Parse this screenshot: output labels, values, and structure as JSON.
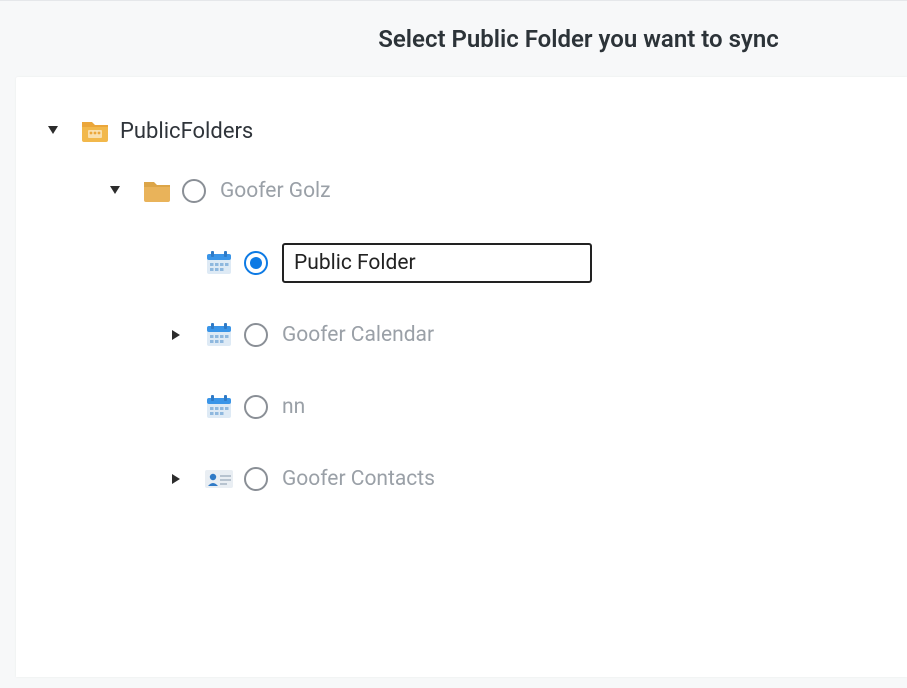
{
  "header": {
    "title": "Select Public Folder you want to sync"
  },
  "tree": {
    "root": {
      "label": "PublicFolders",
      "expanded": true,
      "icon": "folder-people",
      "children": [
        {
          "label": "Goofer Golz",
          "expanded": true,
          "icon": "folder",
          "selected": false,
          "children": [
            {
              "label": "Public Folder",
              "icon": "calendar",
              "selected": true,
              "editing": true,
              "hasChildren": false
            },
            {
              "label": "Goofer Calendar",
              "icon": "calendar",
              "selected": false,
              "hasChildren": true,
              "expanded": false
            },
            {
              "label": "nn",
              "icon": "calendar",
              "selected": false,
              "hasChildren": false
            },
            {
              "label": "Goofer Contacts",
              "icon": "contacts",
              "selected": false,
              "hasChildren": true,
              "expanded": false
            }
          ]
        }
      ]
    }
  }
}
